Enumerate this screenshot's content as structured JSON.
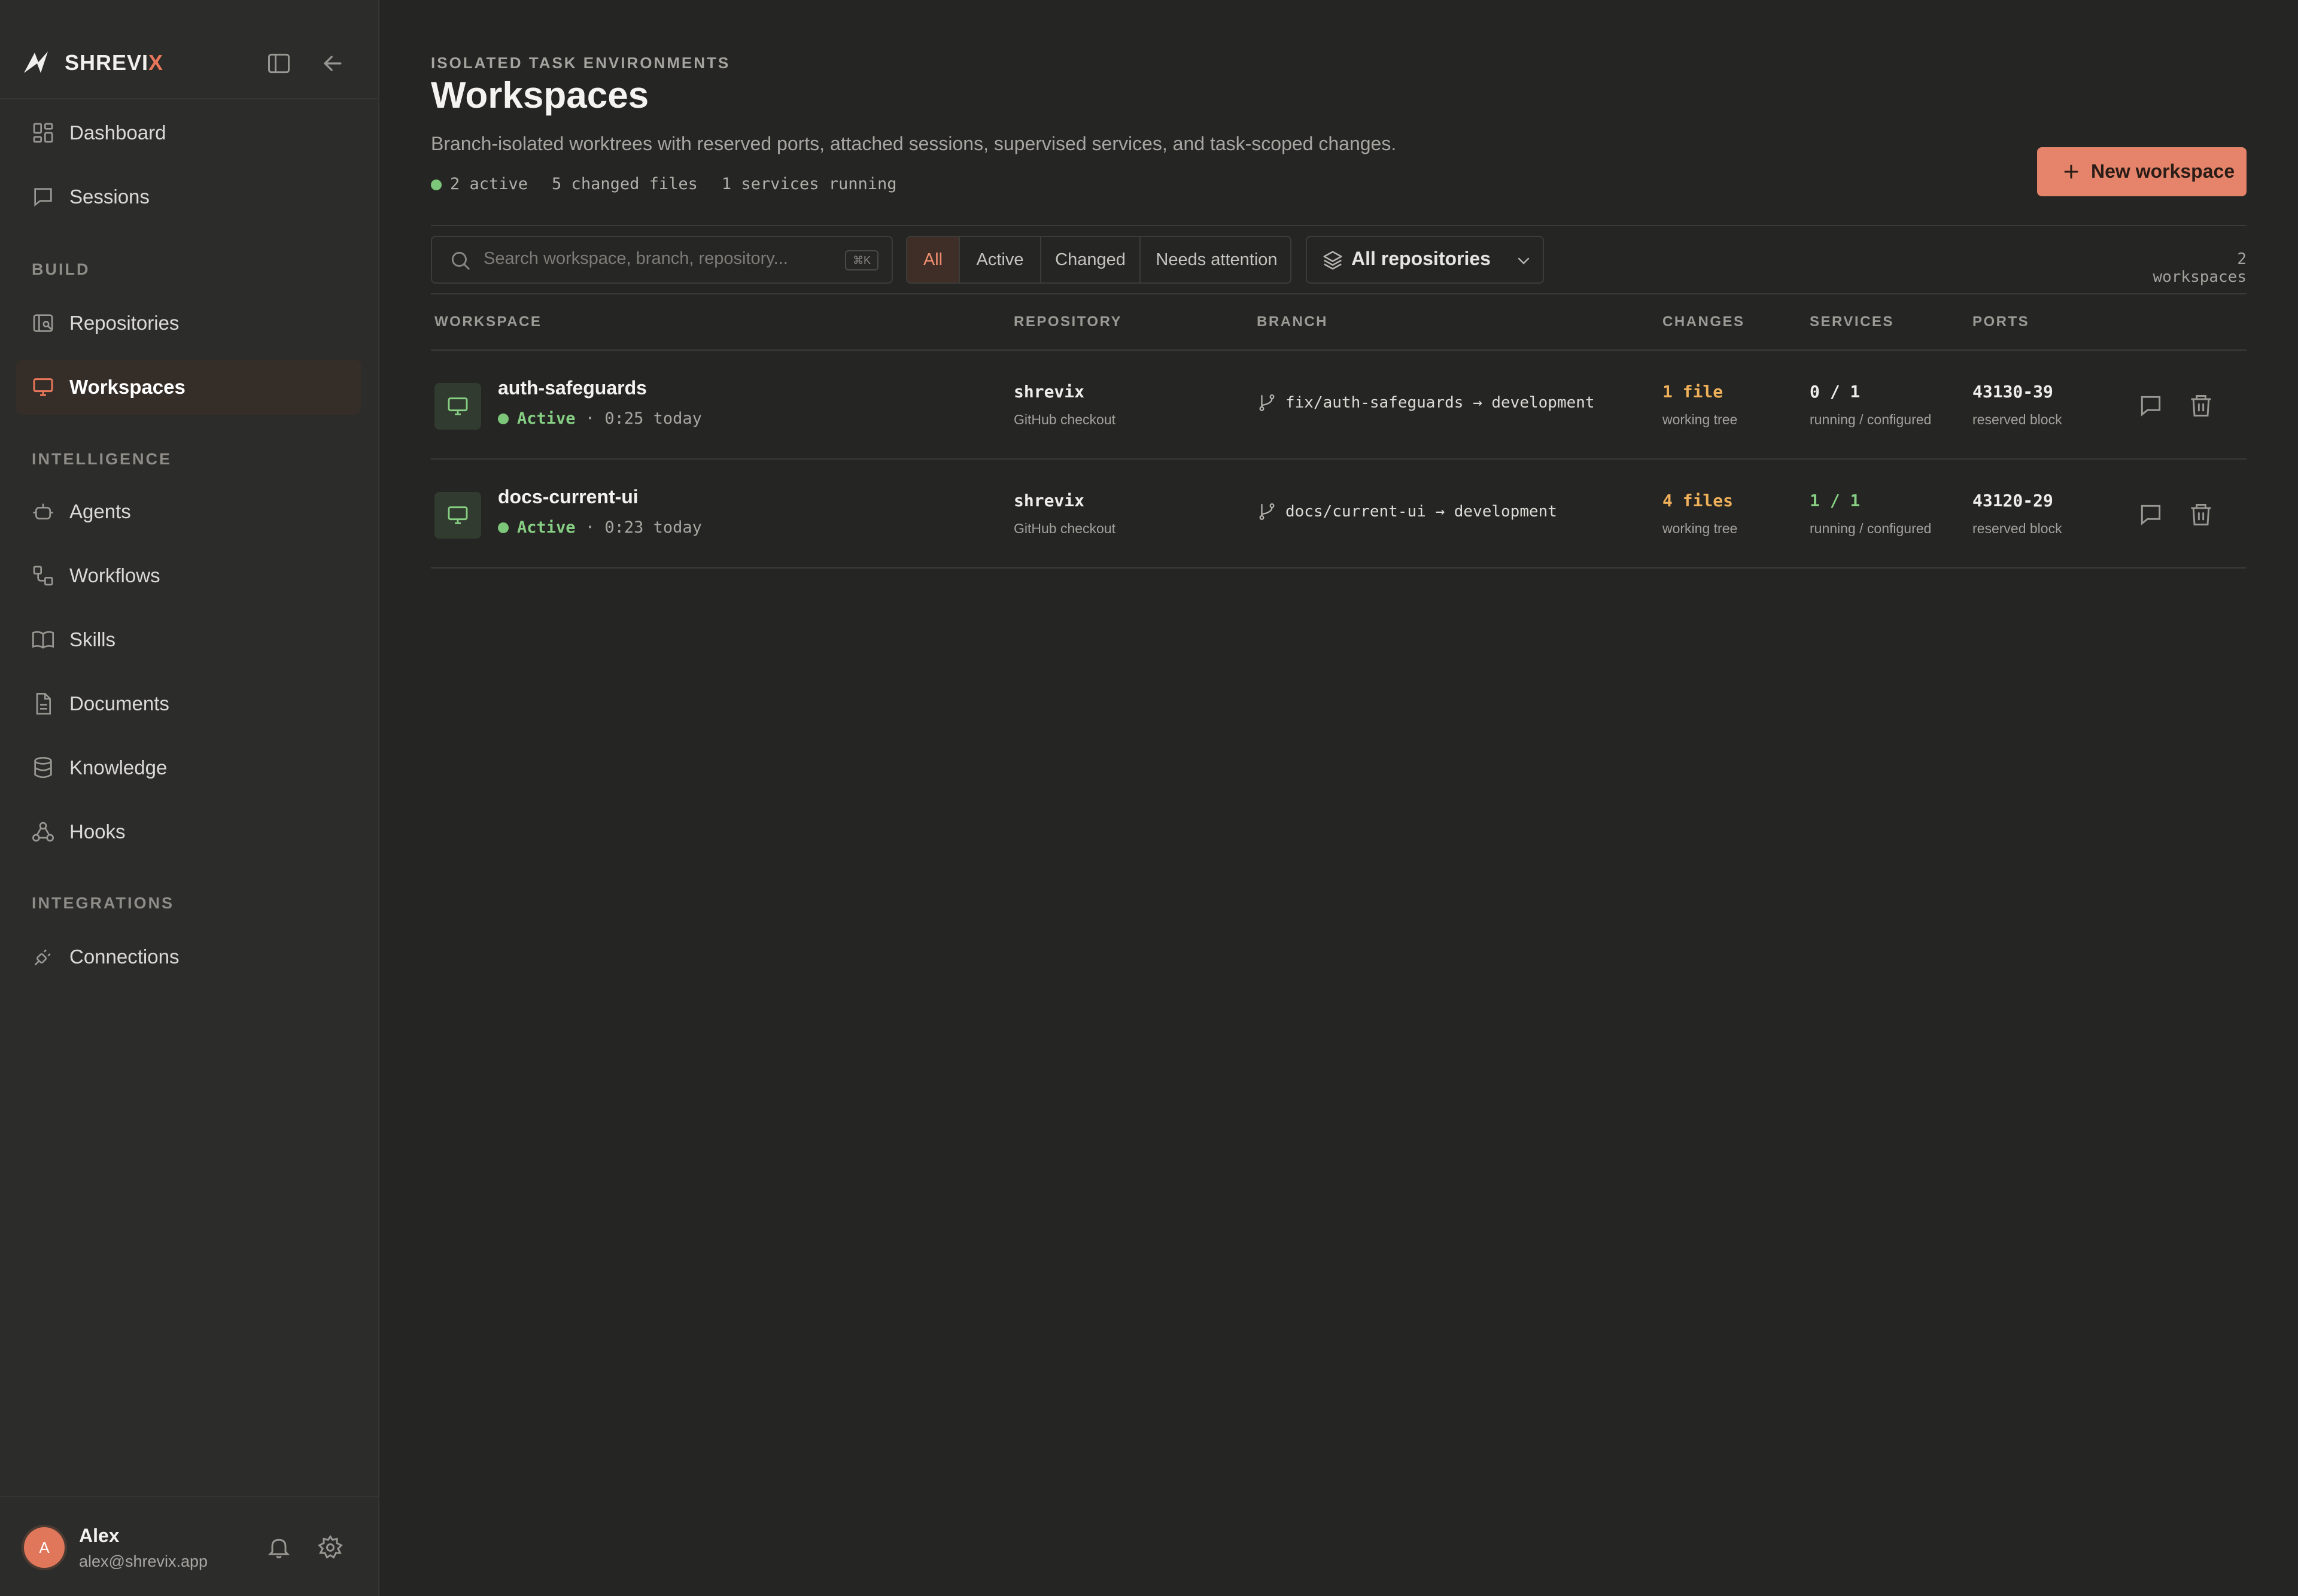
{
  "brand": {
    "name_prefix": "SHREVI",
    "name_suffix": "X"
  },
  "sidebar": {
    "items_top": [
      {
        "label": "Dashboard",
        "icon": "dashboard-icon"
      },
      {
        "label": "Sessions",
        "icon": "chat-icon"
      }
    ],
    "section_build": "BUILD",
    "items_build": [
      {
        "label": "Repositories",
        "icon": "repository-icon"
      },
      {
        "label": "Workspaces",
        "icon": "monitor-icon",
        "active": true
      }
    ],
    "section_intelligence": "INTELLIGENCE",
    "items_intelligence": [
      {
        "label": "Agents",
        "icon": "bot-icon"
      },
      {
        "label": "Workflows",
        "icon": "workflow-icon"
      },
      {
        "label": "Skills",
        "icon": "book-icon"
      },
      {
        "label": "Documents",
        "icon": "document-icon"
      },
      {
        "label": "Knowledge",
        "icon": "database-icon"
      },
      {
        "label": "Hooks",
        "icon": "webhook-icon"
      }
    ],
    "section_integrations": "INTEGRATIONS",
    "items_integrations": [
      {
        "label": "Connections",
        "icon": "plug-icon"
      }
    ]
  },
  "user": {
    "initial": "A",
    "name": "Alex",
    "email": "alex@shrevix.app"
  },
  "header": {
    "eyebrow": "ISOLATED TASK ENVIRONMENTS",
    "title": "Workspaces",
    "subtitle": "Branch-isolated worktrees with reserved ports, attached sessions, supervised services, and task-scoped changes.",
    "stats": [
      "2 active",
      "5 changed files",
      "1 services running"
    ],
    "new_button": "New workspace"
  },
  "toolbar": {
    "search_placeholder": "Search workspace, branch, repository...",
    "search_shortcut": "⌘K",
    "filters": [
      "All",
      "Active",
      "Changed",
      "Needs attention"
    ],
    "active_filter": "All",
    "repo_select": "All repositories",
    "count": "2 workspaces"
  },
  "table": {
    "headers": {
      "workspace": "WORKSPACE",
      "repository": "REPOSITORY",
      "branch": "BRANCH",
      "changes": "CHANGES",
      "services": "SERVICES",
      "ports": "PORTS"
    },
    "rows": [
      {
        "name": "auth-safeguards",
        "status": "Active",
        "time": "· 0:25 today",
        "repo": "shrevix",
        "repo_sub": "GitHub checkout",
        "branch": "fix/auth-safeguards → development",
        "changes": "1 file",
        "changes_sub": "working tree",
        "services": "0 / 1",
        "services_sub": "running / configured",
        "ports": "43130-39",
        "ports_sub": "reserved block"
      },
      {
        "name": "docs-current-ui",
        "status": "Active",
        "time": "· 0:23 today",
        "repo": "shrevix",
        "repo_sub": "GitHub checkout",
        "branch": "docs/current-ui → development",
        "changes": "4 files",
        "changes_sub": "working tree",
        "services": "1 / 1",
        "services_sub": "running / configured",
        "ports": "43120-29",
        "ports_sub": "reserved block"
      }
    ]
  },
  "colors": {
    "accent": "#e5846a",
    "active_green": "#86cf83",
    "changes_amber": "#efb05a",
    "background": "#252523",
    "sidebar": "#2c2c2a"
  }
}
